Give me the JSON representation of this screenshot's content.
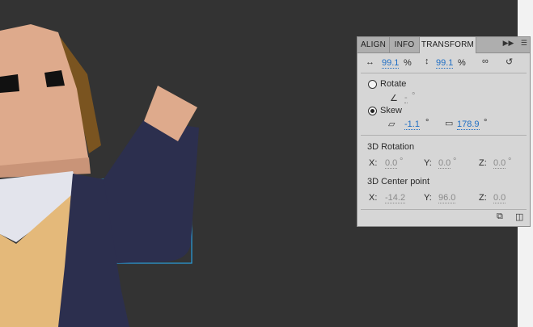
{
  "panel": {
    "tabs": [
      {
        "label": "ALIGN"
      },
      {
        "label": "INFO"
      },
      {
        "label": "TRANSFORM"
      }
    ],
    "scale": {
      "width_value": "99.1",
      "width_unit": "%",
      "height_value": "99.1",
      "height_unit": "%"
    },
    "rotate": {
      "label": "Rotate",
      "value": "-",
      "unit": "°"
    },
    "skew": {
      "label": "Skew",
      "horizontal_value": "-1.1",
      "horizontal_unit": "°",
      "vertical_value": "178.9",
      "vertical_unit": "°"
    },
    "rotation_3d": {
      "label": "3D Rotation",
      "x_label": "X:",
      "x_value": "0.0",
      "y_label": "Y:",
      "y_value": "0.0",
      "z_label": "Z:",
      "z_value": "0.0",
      "unit": "°"
    },
    "center_3d": {
      "label": "3D Center point",
      "x_label": "X:",
      "x_value": "-14.2",
      "y_label": "Y:",
      "y_value": "96.0",
      "z_label": "Z:",
      "z_value": "0.0"
    }
  },
  "colors": {
    "stage": "#333333",
    "panel": "#d6d6d6",
    "value_blue": "#1f6ec4",
    "selection": "#2aa0e0",
    "skin": "#deaa8c",
    "hair": "#7a5420",
    "jacket": "#2c2f4e",
    "sweater": "#e4b97a",
    "shirt": "#e3e4ec"
  }
}
